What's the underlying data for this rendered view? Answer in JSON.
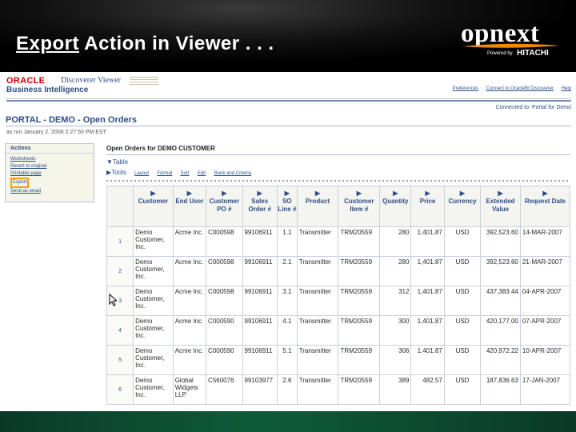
{
  "slide": {
    "title_underlined": "Export",
    "title_rest": " Action in Viewer . . .",
    "logo_word": "opnext",
    "logo_powered": "Powered by",
    "logo_hitachi": "HITACHI"
  },
  "app": {
    "oracle": "ORACLE",
    "product": "Discoverer Viewer",
    "subtitle": "Business Intelligence",
    "global_links": [
      "Preferences",
      "Connect to OracleBI Discoverer",
      "Help"
    ],
    "connected": "Connected to: Portal for Demo"
  },
  "page": {
    "title": "PORTAL - DEMO - Open Orders",
    "run_info": "as run January 2, 2006 2:27:50 PM EST"
  },
  "actions": {
    "title": "Actions",
    "items": [
      "Worksheets",
      "Revert to original",
      "Printable page",
      "Export",
      "Send as email"
    ]
  },
  "report": {
    "title": "Open Orders for DEMO CUSTOMER",
    "table_label": "Table",
    "tools_label": "Tools",
    "tool_links": [
      "Layout",
      "Format",
      "Sort",
      "Edit",
      "Rank and Criteria"
    ]
  },
  "table": {
    "headers": [
      "Customer",
      "End User",
      "Customer PO #",
      "Sales Order #",
      "SO Line #",
      "Product",
      "Customer Item #",
      "Quantity",
      "Price",
      "Currency",
      "Extended Value",
      "Request Date"
    ],
    "rows": [
      {
        "n": "1",
        "cells": [
          "Demo Customer, Inc.",
          "Acme Inc.",
          "C000598",
          "99106911",
          "1.1",
          "Transmitter",
          "TRM20559",
          "280",
          "1,401.87",
          "USD",
          "392,523.60",
          "14-MAR-2007"
        ]
      },
      {
        "n": "2",
        "cells": [
          "Demo Customer, Inc.",
          "Acme Inc.",
          "C000598",
          "99106911",
          "2.1",
          "Transmitter",
          "TRM20559",
          "280",
          "1,401.87",
          "USD",
          "392,523.60",
          "21-MAR-2007"
        ]
      },
      {
        "n": "3",
        "cells": [
          "Demo Customer, Inc.",
          "Acme Inc.",
          "C000598",
          "99106911",
          "3.1",
          "Transmitter",
          "TRM20559",
          "312",
          "1,401.87",
          "USD",
          "437,383.44",
          "04-APR-2007"
        ]
      },
      {
        "n": "4",
        "cells": [
          "Demo Customer, Inc.",
          "Acme Inc.",
          "C000590",
          "99106911",
          "4.1",
          "Transmitter",
          "TRM20559",
          "300",
          "1,401.87",
          "USD",
          "420,177.00",
          "07-APR-2007"
        ]
      },
      {
        "n": "5",
        "cells": [
          "Demo Customer, Inc.",
          "Acme Inc.",
          "C000590",
          "99106911",
          "5.1",
          "Transmitter",
          "TRM20559",
          "306",
          "1,401.87",
          "USD",
          "420,972.22",
          "10-APR-2007"
        ]
      },
      {
        "n": "6",
        "cells": [
          "Demo Customer, Inc.",
          "Global Widgets LLP",
          "C560076",
          "99103977",
          "2.6",
          "Transmitter",
          "TRM20559",
          "389",
          "482.57",
          "USD",
          "187,836.63",
          "17-JAN-2007"
        ]
      }
    ]
  },
  "colors": {
    "link_blue": "#2d4d86",
    "oracle_red": "#cc0000",
    "export_highlight": "#f0a000",
    "logo_swoosh": "#f08a00",
    "bottom_bar": "#0e5b3a"
  }
}
